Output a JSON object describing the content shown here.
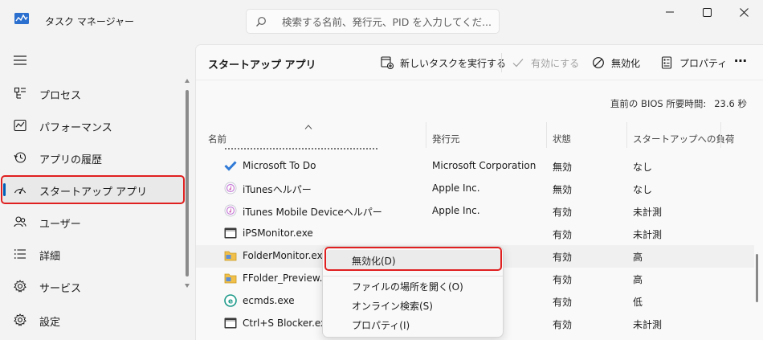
{
  "window": {
    "title": "タスク マネージャー",
    "search_placeholder": "検索する名前、発行元、PID を入力してくだ..."
  },
  "sidebar": {
    "items": [
      {
        "label": "プロセス",
        "icon": "processes-icon"
      },
      {
        "label": "パフォーマンス",
        "icon": "performance-icon"
      },
      {
        "label": "アプリの履歴",
        "icon": "app-history-icon"
      },
      {
        "label": "スタートアップ アプリ",
        "icon": "startup-icon",
        "active": true
      },
      {
        "label": "ユーザー",
        "icon": "users-icon"
      },
      {
        "label": "詳細",
        "icon": "details-icon"
      },
      {
        "label": "サービス",
        "icon": "services-icon"
      }
    ],
    "settings_label": "設定"
  },
  "page": {
    "title": "スタートアップ アプリ",
    "toolbar": {
      "run_new_task": "新しいタスクを実行する",
      "enable": "有効にする",
      "disable": "無効化",
      "properties": "プロパティ"
    },
    "bios_label": "直前の BIOS 所要時間:",
    "bios_value": "23.6 秒"
  },
  "table": {
    "columns": [
      "名前",
      "発行元",
      "状態",
      "スタートアップへの負荷"
    ],
    "rows": [
      {
        "name": "Microsoft To Do",
        "publisher": "Microsoft Corporation",
        "status": "無効",
        "impact": "なし",
        "icon": "todo-check-icon"
      },
      {
        "name": "iTunesヘルパー",
        "publisher": "Apple Inc.",
        "status": "無効",
        "impact": "なし",
        "icon": "itunes-icon"
      },
      {
        "name": "iTunes Mobile Deviceヘルパー",
        "publisher": "Apple Inc.",
        "status": "有効",
        "impact": "未計測",
        "icon": "itunes-icon"
      },
      {
        "name": "iPSMonitor.exe",
        "publisher": "",
        "status": "有効",
        "impact": "未計測",
        "icon": "monitor-app-icon"
      },
      {
        "name": "FolderMonitor.exe",
        "publisher": "",
        "status": "有効",
        "impact": "高",
        "icon": "folder-app-icon"
      },
      {
        "name": "FFolder_Preview.exe",
        "publisher": "",
        "status": "有効",
        "impact": "高",
        "icon": "folder-app-icon"
      },
      {
        "name": "ecmds.exe",
        "publisher": "",
        "status": "有効",
        "impact": "低",
        "icon": "ecmds-icon"
      },
      {
        "name": "Ctrl+S Blocker.exe",
        "publisher": "",
        "status": "有効",
        "impact": "未計測",
        "icon": "monitor-app-icon"
      }
    ]
  },
  "context_menu": {
    "items": [
      "無効化(D)",
      "ファイルの場所を開く(O)",
      "オンライン検索(S)",
      "プロパティ(I)"
    ]
  },
  "colors": {
    "accent": "#005fb8",
    "annotation_red": "#e02020"
  }
}
